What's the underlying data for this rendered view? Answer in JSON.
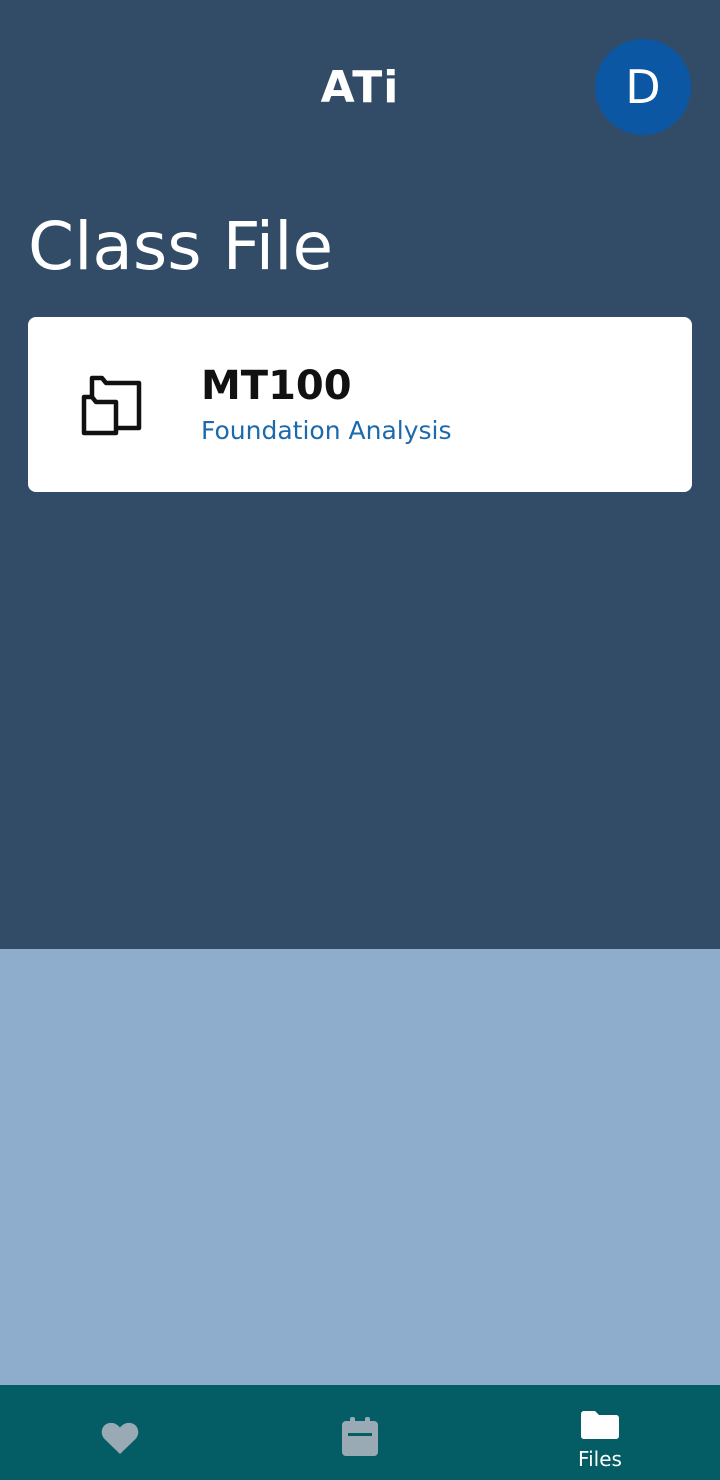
{
  "header": {
    "logo_text": "ATi",
    "avatar_initial": "D"
  },
  "page": {
    "title": "Class File"
  },
  "class_card": {
    "code": "MT100",
    "name": "Foundation Analysis",
    "icon": "folder-copy-icon"
  },
  "bottom_nav": {
    "items": [
      {
        "icon": "heart-icon",
        "label": "",
        "active": false
      },
      {
        "icon": "calendar-icon",
        "label": "",
        "active": false
      },
      {
        "icon": "folder-icon",
        "label": "Files",
        "active": true
      }
    ]
  },
  "colors": {
    "header_background": "#324c67",
    "body_background": "#8eaccb",
    "avatar_background": "#0b57a4",
    "nav_background": "#045d65",
    "nav_inactive_icon": "#9aaab5",
    "subtitle_link": "#1c6aab"
  }
}
